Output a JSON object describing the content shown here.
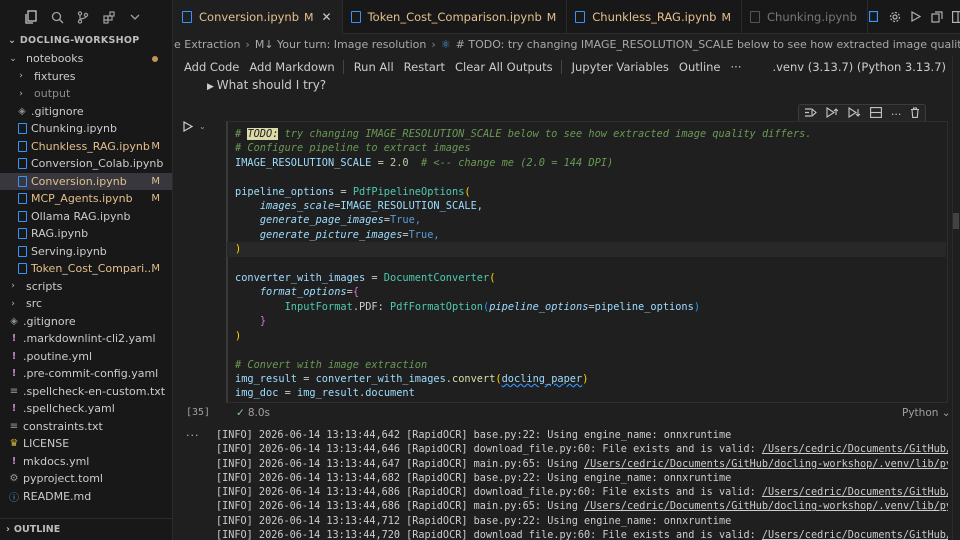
{
  "sidebar": {
    "section_title": "DOCLING-WORKSHOP",
    "tree": [
      {
        "label": "notebooks",
        "type": "folder",
        "open": true,
        "depth": 0,
        "status": "dot"
      },
      {
        "label": "fixtures",
        "type": "folder",
        "open": false,
        "depth": 1
      },
      {
        "label": "output",
        "type": "folder",
        "open": false,
        "depth": 1,
        "ignored": true
      },
      {
        "label": ".gitignore",
        "type": "git",
        "depth": 1
      },
      {
        "label": "Chunking.ipynb",
        "type": "notebook",
        "depth": 1
      },
      {
        "label": "Chunkless_RAG.ipynb",
        "type": "notebook",
        "depth": 1,
        "badge": "M"
      },
      {
        "label": "Conversion_Colab.ipynb",
        "type": "notebook",
        "depth": 1
      },
      {
        "label": "Conversion.ipynb",
        "type": "notebook",
        "depth": 1,
        "badge": "M",
        "active": true
      },
      {
        "label": "MCP_Agents.ipynb",
        "type": "notebook",
        "depth": 1,
        "badge": "M"
      },
      {
        "label": "Ollama RAG.ipynb",
        "type": "notebook",
        "depth": 1
      },
      {
        "label": "RAG.ipynb",
        "type": "notebook",
        "depth": 1
      },
      {
        "label": "Serving.ipynb",
        "type": "notebook",
        "depth": 1
      },
      {
        "label": "Token_Cost_Compari...",
        "type": "notebook",
        "depth": 1,
        "badge": "M"
      },
      {
        "label": "scripts",
        "type": "folder",
        "open": false,
        "depth": 0
      },
      {
        "label": "src",
        "type": "folder",
        "open": false,
        "depth": 0
      },
      {
        "label": ".gitignore",
        "type": "git",
        "depth": 0
      },
      {
        "label": ".markdownlint-cli2.yaml",
        "type": "yaml",
        "depth": 0
      },
      {
        "label": ".poutine.yml",
        "type": "yaml",
        "depth": 0
      },
      {
        "label": ".pre-commit-config.yaml",
        "type": "yaml",
        "depth": 0
      },
      {
        "label": ".spellcheck-en-custom.txt",
        "type": "text",
        "depth": 0
      },
      {
        "label": ".spellcheck.yaml",
        "type": "yaml",
        "depth": 0
      },
      {
        "label": "constraints.txt",
        "type": "text",
        "depth": 0
      },
      {
        "label": "LICENSE",
        "type": "license",
        "depth": 0
      },
      {
        "label": "mkdocs.yml",
        "type": "yaml",
        "depth": 0
      },
      {
        "label": "pyproject.toml",
        "type": "python",
        "depth": 0
      },
      {
        "label": "README.md",
        "type": "markdown",
        "depth": 0
      }
    ],
    "outline_title": "OUTLINE"
  },
  "tabs": [
    {
      "label": "Conversion.ipynb",
      "badge": "M",
      "active": true,
      "close": "✕"
    },
    {
      "label": "Token_Cost_Comparison.ipynb",
      "badge": "M"
    },
    {
      "label": "Chunkless_RAG.ipynb",
      "badge": "M"
    },
    {
      "label": "Chunking.ipynb",
      "dim": true
    }
  ],
  "breadcrumb": {
    "part1": "e Extraction",
    "part2": "M↓ Your turn: Image resolution",
    "part3": "# TODO: try changing IMAGE_RESOLUTION_SCALE below to see how extracted image quality differs."
  },
  "toolbar": {
    "add_code": "Add Code",
    "add_markdown": "Add Markdown",
    "run_all": "Run All",
    "restart": "Restart",
    "clear_outputs": "Clear All Outputs",
    "variables": "Jupyter Variables",
    "outline": "Outline",
    "more": "···",
    "kernel": ".venv (3.13.7) (Python 3.13.7)"
  },
  "disclosure": "What should I try?",
  "cell": {
    "exec_count": "[35]",
    "exec_time": "8.0s",
    "language": "Python",
    "code": {
      "l1_todo": "TODO:",
      "l1_rest": " try changing IMAGE_RESOLUTION_SCALE below to see how extracted image quality differs.",
      "l2": "# Configure pipeline to extract images",
      "l3_var": "IMAGE_RESOLUTION_SCALE",
      "l3_num": "2.0",
      "l3_cm": "# <-- change me (2.0 = 144 DPI)",
      "l5_var": "pipeline_options",
      "l5_cls": "PdfPipelineOptions",
      "l6_kw": "images_scale",
      "l6_val": "IMAGE_RESOLUTION_SCALE,",
      "l7_kw": "generate_page_images",
      "l7_val": "True,",
      "l8_kw": "generate_picture_images",
      "l8_val": "True,",
      "l11_var": "converter_with_images",
      "l11_cls": "DocumentConverter",
      "l12_kw": "format_options",
      "l13_a": "InputFormat",
      "l13_b": ".PDF: ",
      "l13_cls": "PdfFormatOption",
      "l13_kw": "pipeline_options",
      "l13_val": "pipeline_options",
      "l17_cm": "# Convert with image extraction",
      "l18_var": "img_result",
      "l18_obj": "converter_with_images",
      "l18_fn": "convert",
      "l18_arg": "docling_paper",
      "l19_var": "img_doc",
      "l19_obj": "img_result",
      "l19_attr": "document"
    }
  },
  "output_lines": [
    {
      "text": "[INFO] 2026-06-14 13:13:44,642 [RapidOCR] base.py:22: Using engine_name: onnxruntime",
      "link": ""
    },
    {
      "text": "[INFO] 2026-06-14 13:13:44,646 [RapidOCR] download_file.py:60: File exists and is valid: ",
      "link": "/Users/cedric/Documents/GitHub/docling"
    },
    {
      "text": "[INFO] 2026-06-14 13:13:44,647 [RapidOCR] main.py:65: Using ",
      "link": "/Users/cedric/Documents/GitHub/docling-workshop/.venv/lib/python3.1"
    },
    {
      "text": "[INFO] 2026-06-14 13:13:44,682 [RapidOCR] base.py:22: Using engine_name: onnxruntime",
      "link": ""
    },
    {
      "text": "[INFO] 2026-06-14 13:13:44,686 [RapidOCR] download_file.py:60: File exists and is valid: ",
      "link": "/Users/cedric/Documents/GitHub/docling"
    },
    {
      "text": "[INFO] 2026-06-14 13:13:44,686 [RapidOCR] main.py:65: Using ",
      "link": "/Users/cedric/Documents/GitHub/docling-workshop/.venv/lib/python3.1"
    },
    {
      "text": "[INFO] 2026-06-14 13:13:44,712 [RapidOCR] base.py:22: Using engine_name: onnxruntime",
      "link": ""
    },
    {
      "text": "[INFO] 2026-06-14 13:13:44,720 [RapidOCR] download_file.py:60: File exists and is valid: ",
      "link": "/Users/cedric/Documents/GitHub/docling"
    }
  ],
  "colors": {
    "modified": "#e2c08d",
    "accent": "#3794ff",
    "comment": "#6a9955"
  }
}
